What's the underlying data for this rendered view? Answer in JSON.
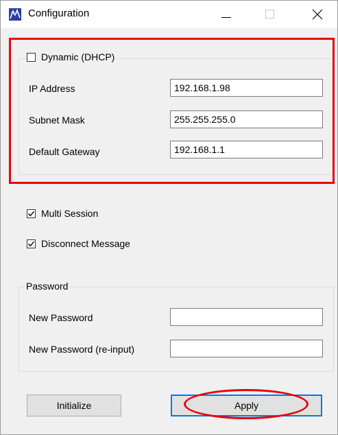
{
  "window": {
    "title": "Configuration",
    "app_icon": "configuration-app-icon",
    "controls": [
      "minimize-icon",
      "maximize-icon",
      "close-icon"
    ]
  },
  "network": {
    "dhcp_label": "Dynamic (DHCP)",
    "dhcp_checked": false,
    "ip_label": "IP Address",
    "ip_value": "192.168.1.98",
    "subnet_label": "Subnet Mask",
    "subnet_value": "255.255.255.0",
    "gateway_label": "Default Gateway",
    "gateway_value": "192.168.1.1"
  },
  "options": {
    "multi_session_label": "Multi Session",
    "multi_session_checked": true,
    "disconnect_label": "Disconnect Message",
    "disconnect_checked": true
  },
  "password": {
    "group_title": "Password",
    "new_label": "New Password",
    "new_value": "",
    "reinput_label": "New Password (re-input)",
    "reinput_value": ""
  },
  "buttons": {
    "initialize_label": "Initialize",
    "apply_label": "Apply"
  },
  "colors": {
    "annotation": "#e8000c",
    "focus_border": "#0a78d7"
  }
}
